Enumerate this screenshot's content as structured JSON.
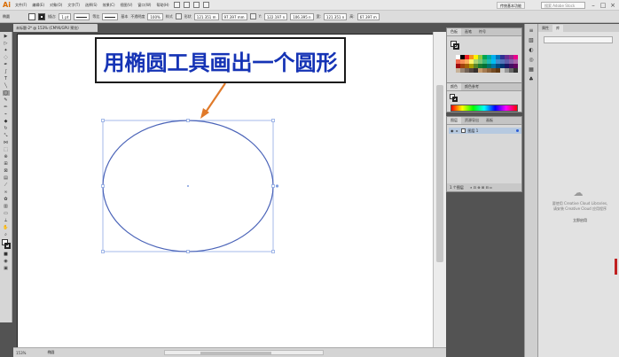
{
  "menubar": {
    "logo": "Ai",
    "items": [
      "文件(F)",
      "编辑(E)",
      "对象(O)",
      "文字(T)",
      "选择(S)",
      "效果(C)",
      "视图(V)",
      "窗口(W)",
      "帮助(H)"
    ],
    "workspace": "传统基本功能",
    "search_placeholder": "搜索 Adobe Stock",
    "minimize": "–",
    "maximize": "□",
    "close": "×"
  },
  "controlbar": {
    "object_label": "椭圆",
    "stroke_label": "描边:",
    "stroke_weight": "1 pt",
    "profile_label": "等比",
    "brush_label": "基本",
    "opacity_label": "不透明度",
    "opacity_value": "100%",
    "style_label": "样式",
    "shape_label": "形状",
    "w_value": "121.351 m",
    "x_label": "X:",
    "x_value": "97.397 mm",
    "y_label": "Y:",
    "y_value": "122.197 n",
    "h_value": "106.395 n",
    "w_label": "宽:",
    "w2_value": "121.351 n",
    "h_label": "高:",
    "h2_value": "67.397 m"
  },
  "document": {
    "tab_title": "未标题-2* @ 153% (CMYK/GPU 预览)",
    "status_zoom": "153%",
    "status_tool": "椭圆"
  },
  "annotation": {
    "text": "用椭圆工具画出一个圆形"
  },
  "panels": {
    "swatches_tabs": [
      "色板",
      "画笔",
      "符号"
    ],
    "color_tabs": [
      "颜色",
      "颜色参考"
    ],
    "layers_tabs": [
      "图层",
      "资源导出",
      "画板"
    ],
    "layer_name": "图层 1",
    "layers_footer": "1 个图层"
  },
  "libraries": {
    "tabs": [
      "属性",
      "库"
    ],
    "select_value": "",
    "message_1": "要使用 Creative Cloud Libraries,",
    "message_2": "请安装 Creative Cloud 应用程序",
    "link": "立即启用"
  },
  "colors": {
    "ellipse_stroke": "#4a63b8",
    "arrow": "#e07a2a",
    "callout_text": "#1533b5",
    "selection": "#7f9de0"
  }
}
